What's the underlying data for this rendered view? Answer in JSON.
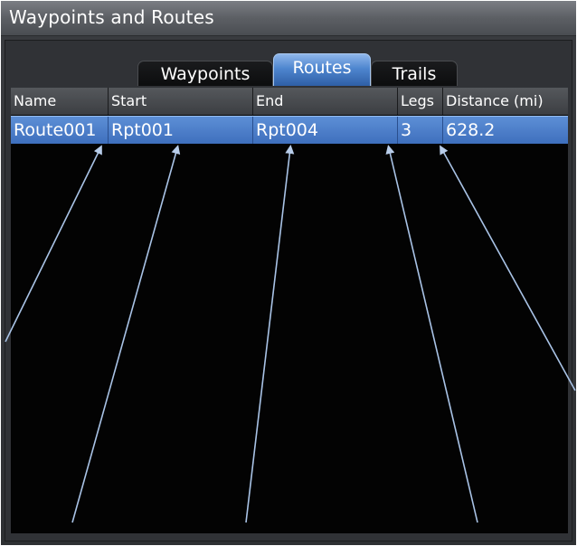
{
  "window": {
    "title": "Waypoints and Routes"
  },
  "tabs": [
    {
      "label": "Waypoints",
      "active": false
    },
    {
      "label": "Routes",
      "active": true
    },
    {
      "label": "Trails",
      "active": false
    }
  ],
  "table": {
    "columns": [
      "Name",
      "Start",
      "End",
      "Legs",
      "Distance (mi)"
    ],
    "rows": [
      [
        "Route001",
        "Rpt001",
        "Rpt004",
        "3",
        "628.2"
      ]
    ],
    "selected_row": 0
  },
  "colors": {
    "title_bar": "#5c5f64",
    "selection": "#4a7cc8",
    "table_background": "#030303",
    "callout_line": "#a9c3e6"
  }
}
